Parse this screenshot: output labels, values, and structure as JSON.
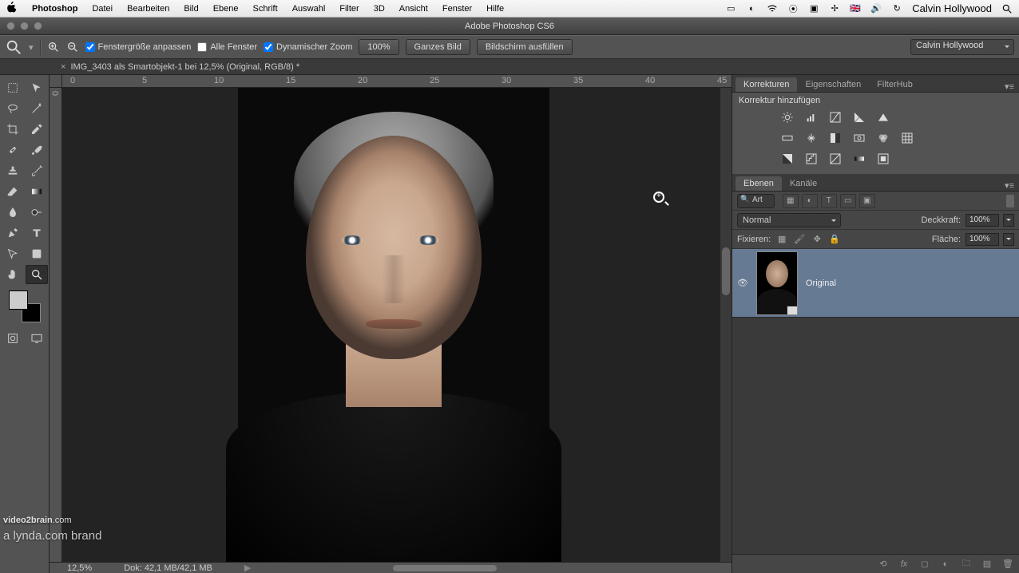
{
  "menubar": {
    "items": [
      "Photoshop",
      "Datei",
      "Bearbeiten",
      "Bild",
      "Ebene",
      "Schrift",
      "Auswahl",
      "Filter",
      "3D",
      "Ansicht",
      "Fenster",
      "Hilfe"
    ],
    "user": "Calvin Hollywood"
  },
  "window": {
    "title": "Adobe Photoshop CS6"
  },
  "options": {
    "fit_window": "Fenstergröße anpassen",
    "all_windows": "Alle Fenster",
    "dynamic_zoom": "Dynamischer Zoom",
    "zoom_pct": "100%",
    "fit_all": "Ganzes Bild",
    "fill_screen": "Bildschirm ausfüllen",
    "workspace": "Calvin Hollywood"
  },
  "doc_tab": "IMG_3403 als Smartobjekt-1 bei 12,5% (Original, RGB/8) *",
  "ruler_marks": [
    "0",
    "5",
    "10",
    "15",
    "20",
    "25",
    "30",
    "35",
    "40",
    "45"
  ],
  "panels": {
    "adj_tabs": [
      "Korrekturen",
      "Eigenschaften",
      "FilterHub"
    ],
    "adj_head": "Korrektur hinzufügen",
    "layer_tabs": [
      "Ebenen",
      "Kanäle"
    ],
    "filter_kind": "Art",
    "blend_mode": "Normal",
    "opacity_label": "Deckkraft:",
    "opacity_val": "100%",
    "lock_label": "Fixieren:",
    "fill_label": "Fläche:",
    "fill_val": "100%",
    "layer_name": "Original"
  },
  "status": {
    "zoom": "12,5%",
    "doc_size": "Dok: 42,1 MB/42,1 MB"
  },
  "watermark": {
    "brand": "video2brain",
    "domain": ".com",
    "sub": "a lynda.com brand"
  }
}
